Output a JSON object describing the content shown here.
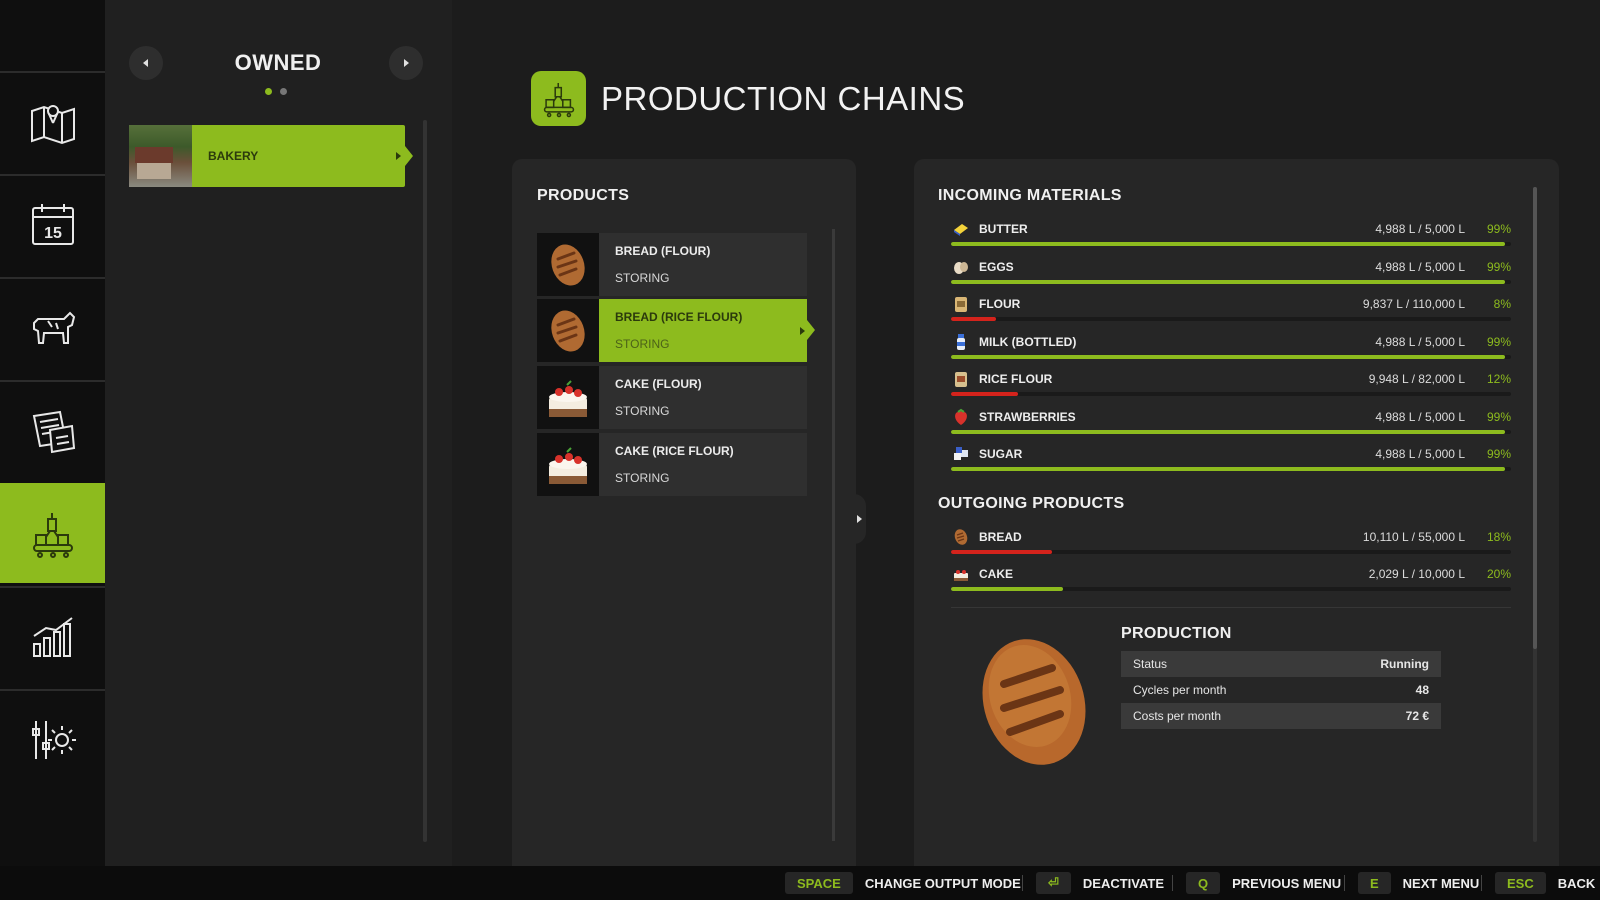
{
  "nav": {
    "items": [
      {
        "icon": "map-icon",
        "active": false
      },
      {
        "icon": "calendar-icon",
        "active": false,
        "day": "15"
      },
      {
        "icon": "cow-icon",
        "active": false
      },
      {
        "icon": "contracts-icon",
        "active": false
      },
      {
        "icon": "production-icon",
        "active": true
      },
      {
        "icon": "stats-icon",
        "active": false
      },
      {
        "icon": "settings-icon",
        "active": false
      }
    ]
  },
  "owned": {
    "title": "OWNED",
    "page_count": 2,
    "current_page": 1,
    "items": [
      {
        "label": "BAKERY",
        "selected": true
      }
    ]
  },
  "header": {
    "title": "PRODUCTION CHAINS"
  },
  "products": {
    "heading": "PRODUCTS",
    "items": [
      {
        "name": "BREAD (FLOUR)",
        "status": "STORING",
        "icon": "bread-icon"
      },
      {
        "name": "BREAD (RICE FLOUR)",
        "status": "STORING",
        "icon": "bread-icon",
        "selected": true
      },
      {
        "name": "CAKE (FLOUR)",
        "status": "STORING",
        "icon": "cake-icon"
      },
      {
        "name": "CAKE (RICE FLOUR)",
        "status": "STORING",
        "icon": "cake-icon"
      }
    ]
  },
  "incoming": {
    "heading": "INCOMING MATERIALS",
    "items": [
      {
        "name": "BUTTER",
        "amount": "4,988 L / 5,000 L",
        "pct": "99%",
        "fill": 0.99,
        "icon": "butter-icon",
        "color": "#8dbb1e"
      },
      {
        "name": "EGGS",
        "amount": "4,988 L / 5,000 L",
        "pct": "99%",
        "fill": 0.99,
        "icon": "eggs-icon",
        "color": "#8dbb1e"
      },
      {
        "name": "FLOUR",
        "amount": "9,837 L / 110,000 L",
        "pct": "8%",
        "fill": 0.08,
        "icon": "flour-icon",
        "color": "#d4231c"
      },
      {
        "name": "MILK (BOTTLED)",
        "amount": "4,988 L / 5,000 L",
        "pct": "99%",
        "fill": 0.99,
        "icon": "milk-icon",
        "color": "#8dbb1e"
      },
      {
        "name": "RICE FLOUR",
        "amount": "9,948 L / 82,000 L",
        "pct": "12%",
        "fill": 0.12,
        "icon": "rice-flour-icon",
        "color": "#d4231c"
      },
      {
        "name": "STRAWBERRIES",
        "amount": "4,988 L / 5,000 L",
        "pct": "99%",
        "fill": 0.99,
        "icon": "strawberry-icon",
        "color": "#8dbb1e"
      },
      {
        "name": "SUGAR",
        "amount": "4,988 L / 5,000 L",
        "pct": "99%",
        "fill": 0.99,
        "icon": "sugar-icon",
        "color": "#8dbb1e"
      }
    ]
  },
  "outgoing": {
    "heading": "OUTGOING PRODUCTS",
    "items": [
      {
        "name": "BREAD",
        "amount": "10,110 L / 55,000 L",
        "pct": "18%",
        "fill": 0.18,
        "icon": "bread-icon",
        "color": "#d4231c"
      },
      {
        "name": "CAKE",
        "amount": "2,029 L / 10,000 L",
        "pct": "20%",
        "fill": 0.2,
        "icon": "cake-icon",
        "color": "#8dbb1e"
      }
    ]
  },
  "production": {
    "heading": "PRODUCTION",
    "status_label": "Status",
    "status_value": "Running",
    "cycles_label": "Cycles per month",
    "cycles_value": "48",
    "costs_label": "Costs per month",
    "costs_value": "72 €"
  },
  "bottom_bar": [
    {
      "key": "SPACE",
      "label": "CHANGE OUTPUT MODE"
    },
    {
      "key": "⏎",
      "label": "DEACTIVATE"
    },
    {
      "key": "Q",
      "label": "PREVIOUS MENU"
    },
    {
      "key": "E",
      "label": "NEXT MENU"
    },
    {
      "key": "ESC",
      "label": "BACK"
    }
  ]
}
